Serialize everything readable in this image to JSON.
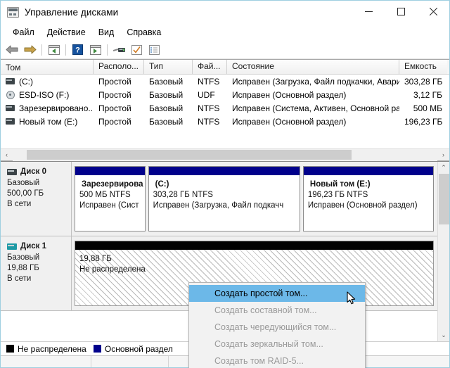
{
  "window": {
    "title": "Управление дисками",
    "icon": "disk-management-icon",
    "minimize_label": "—",
    "maximize_label": "□",
    "close_label": "✕"
  },
  "menubar": {
    "items": [
      {
        "label": "Файл",
        "name": "menu-file"
      },
      {
        "label": "Действие",
        "name": "menu-action"
      },
      {
        "label": "Вид",
        "name": "menu-view"
      },
      {
        "label": "Справка",
        "name": "menu-help"
      }
    ]
  },
  "toolbar": {
    "buttons": [
      {
        "name": "back-arrow-icon",
        "glyph": "◀"
      },
      {
        "name": "forward-arrow-icon",
        "glyph": "▶"
      },
      {
        "name": "show-hide-tree-icon",
        "glyph": "▤"
      },
      {
        "name": "help-icon",
        "glyph": "?"
      },
      {
        "name": "properties-icon",
        "glyph": "▤"
      },
      {
        "name": "rescan-disks-icon",
        "glyph": "⌗"
      },
      {
        "name": "check-icon",
        "glyph": "✓"
      },
      {
        "name": "list-icon",
        "glyph": "☰"
      }
    ]
  },
  "volume_table": {
    "columns": [
      {
        "label": "Том",
        "name": "column-volume"
      },
      {
        "label": "Располо...",
        "name": "column-layout"
      },
      {
        "label": "Тип",
        "name": "column-type"
      },
      {
        "label": "Фай...",
        "name": "column-filesystem"
      },
      {
        "label": "Состояние",
        "name": "column-status"
      },
      {
        "label": "Емкость",
        "name": "column-capacity"
      }
    ],
    "rows": [
      {
        "icon": "drive-icon",
        "volume": "(C:)",
        "layout": "Простой",
        "type": "Базовый",
        "fs": "NTFS",
        "status": "Исправен (Загрузка, Файл подкачки, Авари...",
        "capacity": "303,28 ГБ"
      },
      {
        "icon": "cd-icon",
        "volume": "ESD-ISO (F:)",
        "layout": "Простой",
        "type": "Базовый",
        "fs": "UDF",
        "status": "Исправен (Основной раздел)",
        "capacity": "3,12 ГБ"
      },
      {
        "icon": "drive-icon",
        "volume": "Зарезервировано...",
        "layout": "Простой",
        "type": "Базовый",
        "fs": "NTFS",
        "status": "Исправен (Система, Активен, Основной раз...",
        "capacity": "500 МБ"
      },
      {
        "icon": "drive-icon",
        "volume": "Новый том (E:)",
        "layout": "Простой",
        "type": "Базовый",
        "fs": "NTFS",
        "status": "Исправен (Основной раздел)",
        "capacity": "196,23 ГБ"
      }
    ]
  },
  "disks": [
    {
      "name": "Диск 0",
      "type": "Базовый",
      "size": "500,00 ГБ",
      "state": "В сети",
      "icon_color": "#3c4448",
      "partitions": [
        {
          "name": "Зарезервирова",
          "size_fs": "500 МБ NTFS",
          "status": "Исправен (Сист",
          "bar_color": "#00008b",
          "width_pct": 20
        },
        {
          "name": "(C:)",
          "size_fs": "303,28 ГБ NTFS",
          "status": "Исправен (Загрузка, Файл подкачч",
          "bar_color": "#00008b",
          "width_pct": 43
        },
        {
          "name": "Новый том  (E:)",
          "size_fs": "196,23 ГБ NTFS",
          "status": "Исправен (Основной раздел)",
          "bar_color": "#00008b",
          "width_pct": 37
        }
      ]
    },
    {
      "name": "Диск 1",
      "type": "Базовый",
      "size": "19,88 ГБ",
      "state": "В сети",
      "icon_color": "#1d9aa5",
      "partitions": [
        {
          "name": "",
          "size_fs": "19,88 ГБ",
          "status": "Не распределена",
          "bar_color": "#000000",
          "width_pct": 100,
          "hatched": true
        }
      ]
    }
  ],
  "legend": [
    {
      "label": "Не распределена",
      "color": "#000000",
      "name": "legend-unallocated"
    },
    {
      "label": "Основной раздел",
      "color": "#00008b",
      "name": "legend-primary-partition"
    }
  ],
  "context_menu": {
    "items": [
      {
        "label": "Создать простой том...",
        "enabled": true,
        "highlighted": true,
        "name": "ctx-create-simple-volume"
      },
      {
        "label": "Создать составной том...",
        "enabled": false,
        "highlighted": false,
        "name": "ctx-create-spanned-volume"
      },
      {
        "label": "Создать чередующийся том...",
        "enabled": false,
        "highlighted": false,
        "name": "ctx-create-striped-volume"
      },
      {
        "label": "Создать зеркальный том...",
        "enabled": false,
        "highlighted": false,
        "name": "ctx-create-mirrored-volume"
      },
      {
        "label": "Создать том RAID-5...",
        "enabled": false,
        "highlighted": false,
        "name": "ctx-create-raid5-volume"
      }
    ]
  },
  "scrollbars": {
    "h_left_arrow": "‹",
    "h_right_arrow": "›",
    "v_up_arrow": "⌃",
    "v_down_arrow": "⌄"
  }
}
